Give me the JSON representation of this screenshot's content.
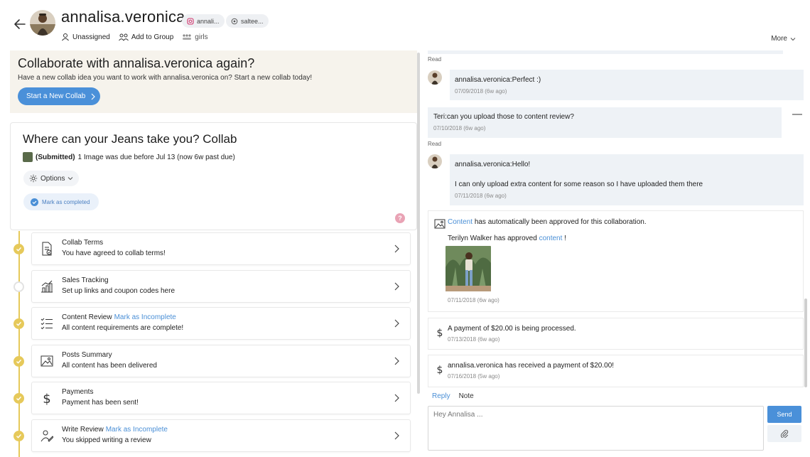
{
  "header": {
    "username": "annalisa.veronica",
    "instagram_handle": "annali...",
    "second_handle": "saltee...",
    "assignee": "Unassigned",
    "add_to_group": "Add to Group",
    "group": "girls",
    "more": "More"
  },
  "banner": {
    "title": "Collaborate with annalisa.veronica again?",
    "subtitle": "Have a new collab idea you want to work with annalisa.veronica on? Start a new collab today!",
    "button": "Start a New Collab"
  },
  "collab": {
    "title": "Where can your Jeans take you? Collab",
    "status_bold": "(Submitted)",
    "status_rest": "1 Image was due before Jul 13 (now 6w past due)",
    "options": "Options",
    "mark_completed": "Mark as completed",
    "help": "?"
  },
  "steps": [
    {
      "title": "Collab Terms",
      "link": "",
      "desc": "You have agreed to collab terms!",
      "done": true,
      "icon": "document-check-icon"
    },
    {
      "title": "Sales Tracking",
      "link": "",
      "desc": "Set up links and coupon codes here",
      "done": false,
      "icon": "chart-icon"
    },
    {
      "title": "Content Review",
      "link": "Mark as Incomplete",
      "desc": "All content requirements are complete!",
      "done": true,
      "icon": "checklist-icon"
    },
    {
      "title": "Posts Summary",
      "link": "",
      "desc": "All content has been delivered",
      "done": true,
      "icon": "image-icon"
    },
    {
      "title": "Payments",
      "link": "",
      "desc": "Payment has been sent!",
      "done": true,
      "icon": "dollar-icon"
    },
    {
      "title": "Write Review",
      "link": "Mark as Incomplete",
      "desc": "You skipped writing a review",
      "done": true,
      "icon": "review-icon"
    }
  ],
  "messages": {
    "read_label": "Read",
    "m1_text": "annalisa.veronica:Perfect :)",
    "m1_time": "07/09/2018 (6w ago)",
    "m2_text": "Teri:can you upload those to content review?",
    "m2_time": "07/10/2018 (6w ago)",
    "m3_line1": "annalisa.veronica:Hello!",
    "m3_line2": "I can only upload extra content for some reason so I have uploaded them there",
    "m3_time": "07/11/2018 (6w ago)"
  },
  "system": {
    "s1_link": "Content",
    "s1_rest": "has automatically been approved for this collaboration.",
    "s1b_pre": "Terilyn Walker has approved",
    "s1b_link": "content",
    "s1b_post": "!",
    "s1_time": "07/11/2018 (6w ago)",
    "s2_text": "A payment of $20.00 is being processed.",
    "s2_time": "07/13/2018 (6w ago)",
    "s3_text": "annalisa.veronica has received a payment of $20.00!",
    "s3_time": "07/16/2018 (5w ago)"
  },
  "composer": {
    "tab_reply": "Reply",
    "tab_note": "Note",
    "placeholder": "Hey Annalisa ...",
    "send": "Send"
  },
  "colors": {
    "accent": "#4a90d9",
    "timeline": "#e6c95a",
    "banner_bg": "#f6f3ec",
    "message_bg": "#eef2f6"
  }
}
